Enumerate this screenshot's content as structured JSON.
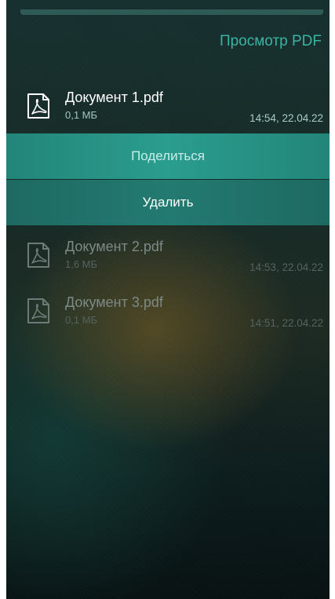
{
  "header": {
    "title": "Просмотр PDF"
  },
  "files": [
    {
      "name": "Документ 1.pdf",
      "size": "0,1 МБ",
      "time": "14:54, 22.04.22",
      "icon": "pdf-file-icon"
    },
    {
      "name": "Документ 2.pdf",
      "size": "1,6 МБ",
      "time": "14:53, 22.04.22",
      "icon": "pdf-file-icon"
    },
    {
      "name": "Документ 3.pdf",
      "size": "0,1 МБ",
      "time": "14:51, 22.04.22",
      "icon": "pdf-file-icon"
    }
  ],
  "context_menu": {
    "share_label": "Поделиться",
    "delete_label": "Удалить"
  },
  "colors": {
    "accent": "#39b4a2",
    "menu_highlight": "#2a9d8e",
    "menu_secondary": "#237a71",
    "background_top": "#16302f",
    "background_bottom": "#071112"
  }
}
